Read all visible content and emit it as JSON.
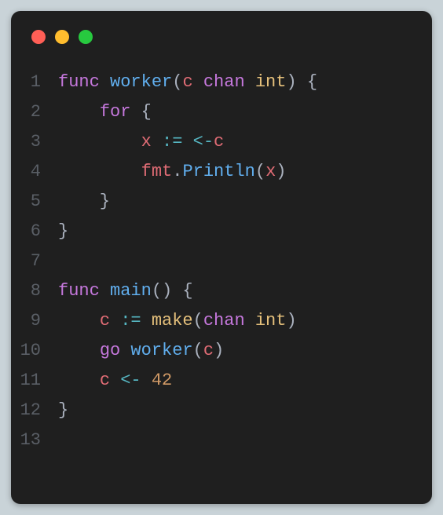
{
  "window": {
    "traffic_lights": [
      "close",
      "minimize",
      "zoom"
    ]
  },
  "code": {
    "language": "go",
    "lines": [
      {
        "n": "1",
        "tokens": [
          {
            "t": "func ",
            "c": "keyword"
          },
          {
            "t": "worker",
            "c": "func"
          },
          {
            "t": "(",
            "c": "plain"
          },
          {
            "t": "c",
            "c": "var"
          },
          {
            "t": " ",
            "c": "plain"
          },
          {
            "t": "chan",
            "c": "keyword"
          },
          {
            "t": " ",
            "c": "plain"
          },
          {
            "t": "int",
            "c": "type"
          },
          {
            "t": ") {",
            "c": "plain"
          }
        ]
      },
      {
        "n": "2",
        "tokens": [
          {
            "t": "    ",
            "c": "plain"
          },
          {
            "t": "for",
            "c": "keyword"
          },
          {
            "t": " {",
            "c": "plain"
          }
        ]
      },
      {
        "n": "3",
        "tokens": [
          {
            "t": "        ",
            "c": "plain"
          },
          {
            "t": "x",
            "c": "var"
          },
          {
            "t": " ",
            "c": "plain"
          },
          {
            "t": ":=",
            "c": "op"
          },
          {
            "t": " ",
            "c": "plain"
          },
          {
            "t": "<-",
            "c": "op"
          },
          {
            "t": "c",
            "c": "var"
          }
        ]
      },
      {
        "n": "4",
        "tokens": [
          {
            "t": "        ",
            "c": "plain"
          },
          {
            "t": "fmt",
            "c": "var"
          },
          {
            "t": ".",
            "c": "plain"
          },
          {
            "t": "Println",
            "c": "func"
          },
          {
            "t": "(",
            "c": "plain"
          },
          {
            "t": "x",
            "c": "var"
          },
          {
            "t": ")",
            "c": "plain"
          }
        ]
      },
      {
        "n": "5",
        "tokens": [
          {
            "t": "    }",
            "c": "plain"
          }
        ]
      },
      {
        "n": "6",
        "tokens": [
          {
            "t": "}",
            "c": "plain"
          }
        ]
      },
      {
        "n": "7",
        "tokens": []
      },
      {
        "n": "8",
        "tokens": [
          {
            "t": "func ",
            "c": "keyword"
          },
          {
            "t": "main",
            "c": "func"
          },
          {
            "t": "() {",
            "c": "plain"
          }
        ]
      },
      {
        "n": "9",
        "tokens": [
          {
            "t": "    ",
            "c": "plain"
          },
          {
            "t": "c",
            "c": "var"
          },
          {
            "t": " ",
            "c": "plain"
          },
          {
            "t": ":=",
            "c": "op"
          },
          {
            "t": " ",
            "c": "plain"
          },
          {
            "t": "make",
            "c": "type"
          },
          {
            "t": "(",
            "c": "plain"
          },
          {
            "t": "chan",
            "c": "keyword"
          },
          {
            "t": " ",
            "c": "plain"
          },
          {
            "t": "int",
            "c": "type"
          },
          {
            "t": ")",
            "c": "plain"
          }
        ]
      },
      {
        "n": "10",
        "tokens": [
          {
            "t": "    ",
            "c": "plain"
          },
          {
            "t": "go",
            "c": "keyword"
          },
          {
            "t": " ",
            "c": "plain"
          },
          {
            "t": "worker",
            "c": "func"
          },
          {
            "t": "(",
            "c": "plain"
          },
          {
            "t": "c",
            "c": "var"
          },
          {
            "t": ")",
            "c": "plain"
          }
        ]
      },
      {
        "n": "11",
        "tokens": [
          {
            "t": "    ",
            "c": "plain"
          },
          {
            "t": "c",
            "c": "var"
          },
          {
            "t": " ",
            "c": "plain"
          },
          {
            "t": "<-",
            "c": "op"
          },
          {
            "t": " ",
            "c": "plain"
          },
          {
            "t": "42",
            "c": "number"
          }
        ]
      },
      {
        "n": "12",
        "tokens": [
          {
            "t": "}",
            "c": "plain"
          }
        ]
      },
      {
        "n": "13",
        "tokens": []
      }
    ]
  }
}
